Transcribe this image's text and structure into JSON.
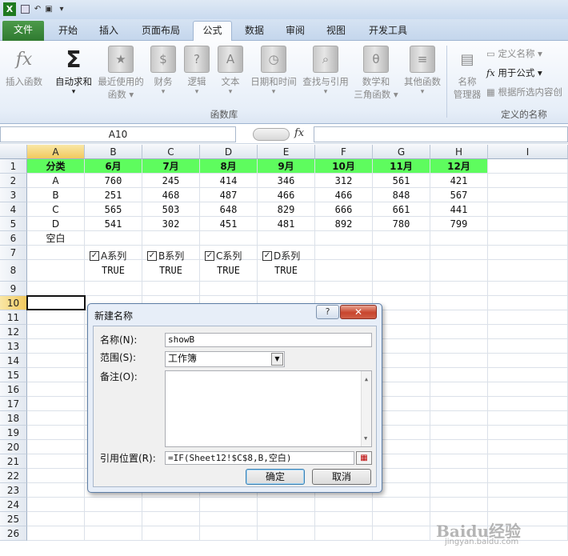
{
  "qat": {
    "excel_icon": "excel-icon",
    "dropdown": "▾"
  },
  "tabs": [
    "文件",
    "开始",
    "插入",
    "页面布局",
    "公式",
    "数据",
    "审阅",
    "视图",
    "开发工具"
  ],
  "ribbon": {
    "insert_function": "插入函数",
    "autosum": "自动求和",
    "autosum_arrow": "▾",
    "recent": [
      "最近使用的",
      "函数 ▾"
    ],
    "financial": [
      "财务",
      "▾"
    ],
    "logical": [
      "逻辑",
      "▾"
    ],
    "text": [
      "文本",
      "▾"
    ],
    "datetime": [
      "日期和时间",
      "▾"
    ],
    "lookup": [
      "查找与引用",
      "▾"
    ],
    "math": [
      "数学和",
      "三角函数 ▾"
    ],
    "other": [
      "其他函数",
      "▾"
    ],
    "group_library": "函数库",
    "name_manager": [
      "名称",
      "管理器"
    ],
    "define_name": "定义名称 ▾",
    "use_in_formula": "用于公式 ▾",
    "create_from_selection": "根据所选内容创",
    "group_defined_names": "定义的名称"
  },
  "formula_bar": {
    "name_box": "A10",
    "fx": "fx",
    "formula": ""
  },
  "columns": [
    "A",
    "B",
    "C",
    "D",
    "E",
    "F",
    "G",
    "H",
    "I"
  ],
  "rows": [
    "1",
    "2",
    "3",
    "4",
    "5",
    "6",
    "7",
    "8",
    "9",
    "10",
    "11",
    "12",
    "13",
    "14",
    "15",
    "16",
    "17",
    "18",
    "19",
    "20",
    "21",
    "22",
    "23",
    "24",
    "25",
    "26"
  ],
  "sheet": {
    "header": [
      "分类",
      "6月",
      "7月",
      "8月",
      "9月",
      "10月",
      "11月",
      "12月"
    ],
    "data": [
      [
        "A",
        "760",
        "245",
        "414",
        "346",
        "312",
        "561",
        "421"
      ],
      [
        "B",
        "251",
        "468",
        "487",
        "466",
        "466",
        "848",
        "567"
      ],
      [
        "C",
        "565",
        "503",
        "648",
        "829",
        "666",
        "661",
        "441"
      ],
      [
        "D",
        "541",
        "302",
        "451",
        "481",
        "892",
        "780",
        "799"
      ]
    ],
    "a6": "空白",
    "checkboxes": [
      "A系列",
      "B系列",
      "C系列",
      "D系列"
    ],
    "check_mark": "✓",
    "truths": [
      "TRUE",
      "TRUE",
      "TRUE",
      "TRUE"
    ]
  },
  "dialog": {
    "title": "新建名称",
    "help": "?",
    "close": "✕",
    "name_label": "名称(N):",
    "name_value": "showB",
    "scope_label": "范围(S):",
    "scope_value": "工作簿",
    "comment_label": "备注(O):",
    "ref_label": "引用位置(R):",
    "ref_value": "=IF(Sheet12!$C$8,B,空白)",
    "ok": "确定",
    "cancel": "取消"
  },
  "watermark": {
    "brand": "Baidu经验",
    "url": "jingyan.baidu.com"
  }
}
